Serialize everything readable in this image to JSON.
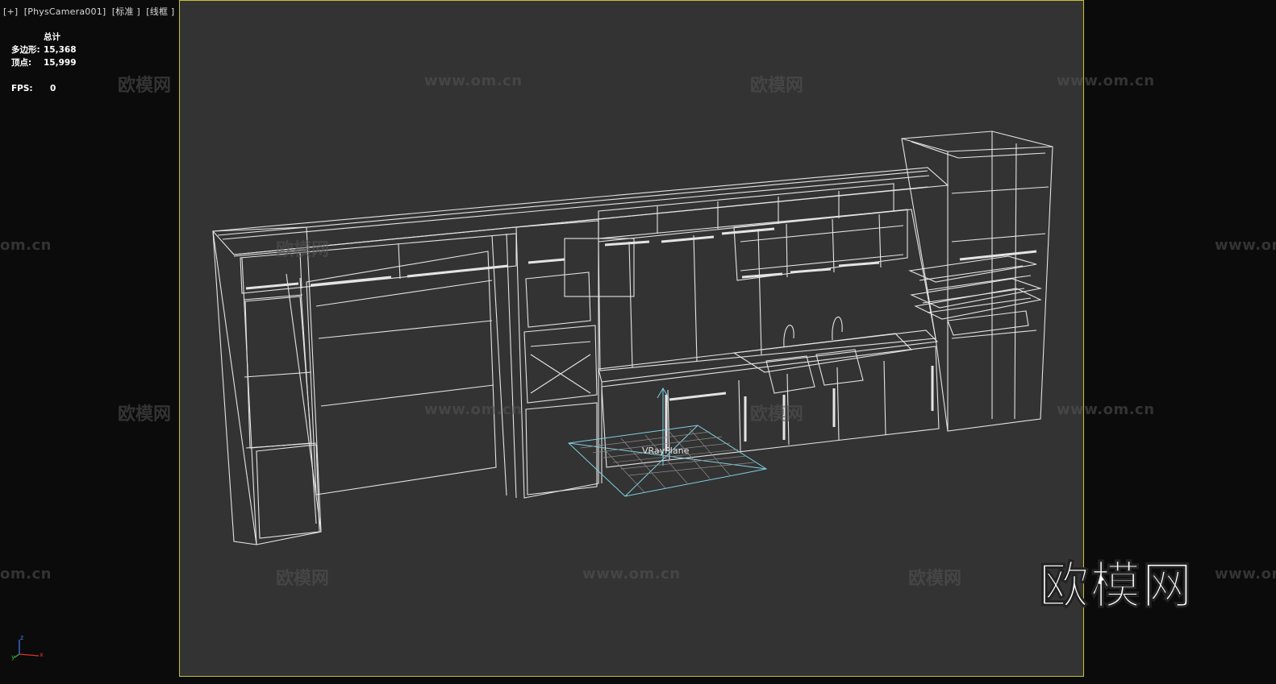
{
  "viewport": {
    "label": "[+]  [PhysCamera001]  [标准 ]  [线框 ]",
    "frame_color": "#c8c032",
    "background": "#333333"
  },
  "stats": {
    "header": "总计",
    "polygons_label": "多边形:",
    "polygons_value": "15,368",
    "vertices_label": "顶点:",
    "vertices_value": "15,999",
    "fps_label": "FPS:",
    "fps_value": "0"
  },
  "scene": {
    "selected_object": "VRayPlane",
    "wire_color": "#e4e4e4",
    "selected_color": "#7fd0e0"
  },
  "watermarks": {
    "logo_text": "欧模网",
    "url_text": "www.om.cn",
    "url_partial": "om.cn"
  },
  "axis": {
    "z": "z",
    "x": "x",
    "y": "y"
  }
}
